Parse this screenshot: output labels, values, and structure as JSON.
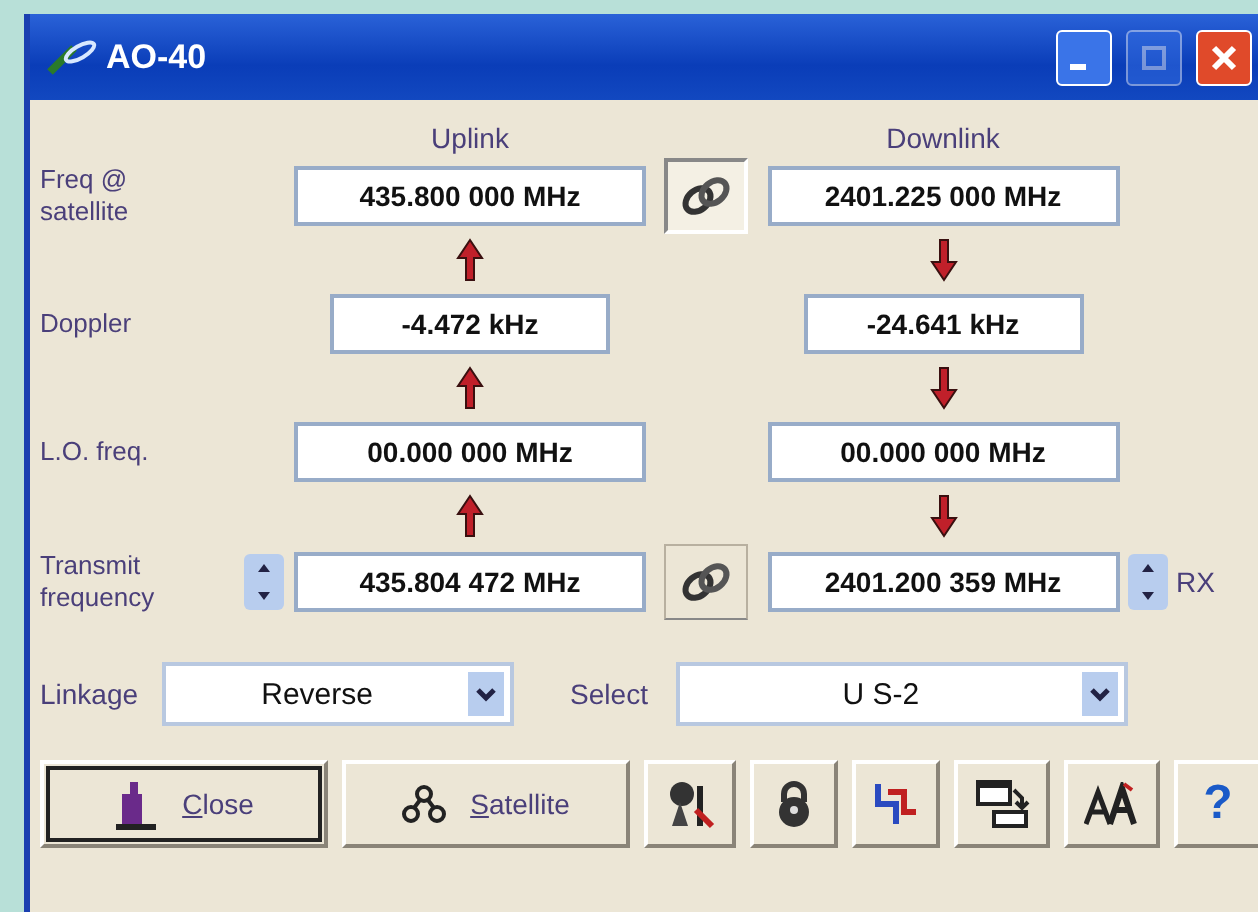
{
  "window": {
    "title": "AO-40",
    "controls": [
      {
        "kind": "minimize",
        "disabled": false
      },
      {
        "kind": "maximize",
        "disabled": true
      },
      {
        "kind": "close",
        "disabled": false
      }
    ]
  },
  "columns": [
    "Uplink",
    "Downlink"
  ],
  "rows": [
    {
      "label": "Freq @ satellite",
      "uplink": "435.800 000 MHz",
      "downlink": "2401.225 000 MHz",
      "narrow": false,
      "middle": {
        "kind": "link",
        "pressed": true
      }
    },
    {
      "label": "Doppler",
      "uplink": "-4.472 kHz",
      "downlink": "-24.641 kHz",
      "narrow": true
    },
    {
      "label": "L.O. freq.",
      "uplink": "00.000 000 MHz",
      "downlink": "00.000 000 MHz",
      "narrow": false
    },
    {
      "label": "Transmit frequency",
      "uplink": "435.804 472 MHz",
      "downlink": "2401.200 359 MHz",
      "narrow": false,
      "middle": {
        "kind": "link",
        "pressed": false
      },
      "spinners": true
    }
  ],
  "rx_label": "RX",
  "linkage": {
    "label": "Linkage",
    "value": "Reverse"
  },
  "select": {
    "label": "Select",
    "value": "U S-2"
  },
  "toolbar": [
    {
      "kind": "close",
      "label": "Close",
      "default": true
    },
    {
      "kind": "satellite",
      "label": "Satellite",
      "default": false
    },
    {
      "kind": "tools",
      "default": false
    },
    {
      "kind": "lock",
      "default": false
    },
    {
      "kind": "steps",
      "default": false
    },
    {
      "kind": "swap",
      "default": false
    },
    {
      "kind": "font",
      "default": false
    },
    {
      "kind": "help",
      "label": "?",
      "default": false
    }
  ]
}
